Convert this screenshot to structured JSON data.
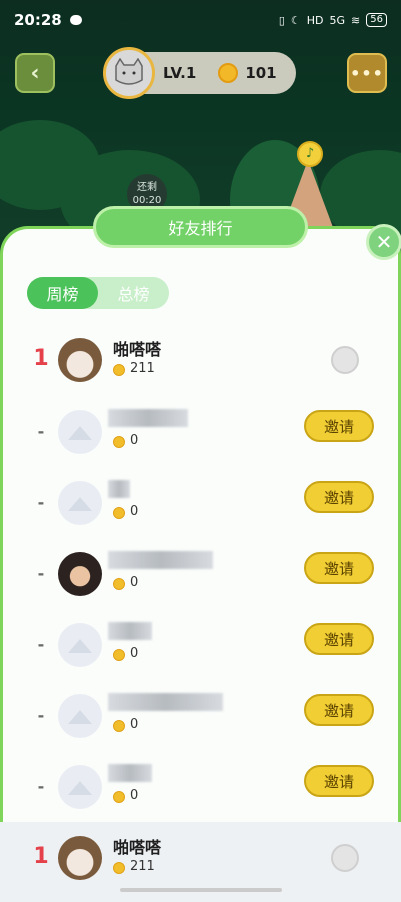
{
  "status_bar": {
    "time": "20:28",
    "network": "5G",
    "battery": "56"
  },
  "header": {
    "level": "LV.1",
    "coins": "101",
    "back_icon": "chevron-left-icon",
    "more_icon": "more-icon"
  },
  "scene": {
    "timer_label": "还剩",
    "timer_value": "00:20"
  },
  "panel": {
    "title": "好友排行",
    "tabs": [
      {
        "label": "周榜",
        "active": true
      },
      {
        "label": "总榜",
        "active": false
      }
    ],
    "invite_label": "邀请"
  },
  "rows": [
    {
      "rank": "1",
      "name": "啪嗒嗒",
      "score": "211",
      "avatar": "cat",
      "action": "medal"
    },
    {
      "rank": "-",
      "name": "",
      "score": "0",
      "avatar": "placeholder",
      "action": "invite",
      "blur_w": 80
    },
    {
      "rank": "-",
      "name": "",
      "score": "0",
      "avatar": "placeholder",
      "action": "invite",
      "blur_w": 22
    },
    {
      "rank": "-",
      "name": "",
      "score": "0",
      "avatar": "girl",
      "action": "invite",
      "blur_w": 105
    },
    {
      "rank": "-",
      "name": "",
      "score": "0",
      "avatar": "placeholder",
      "action": "invite",
      "blur_w": 44
    },
    {
      "rank": "-",
      "name": "",
      "score": "0",
      "avatar": "placeholder",
      "action": "invite",
      "blur_w": 115
    },
    {
      "rank": "-",
      "name": "",
      "score": "0",
      "avatar": "placeholder",
      "action": "invite",
      "blur_w": 44
    }
  ],
  "me": {
    "rank": "1",
    "name": "啪嗒嗒",
    "score": "211"
  }
}
